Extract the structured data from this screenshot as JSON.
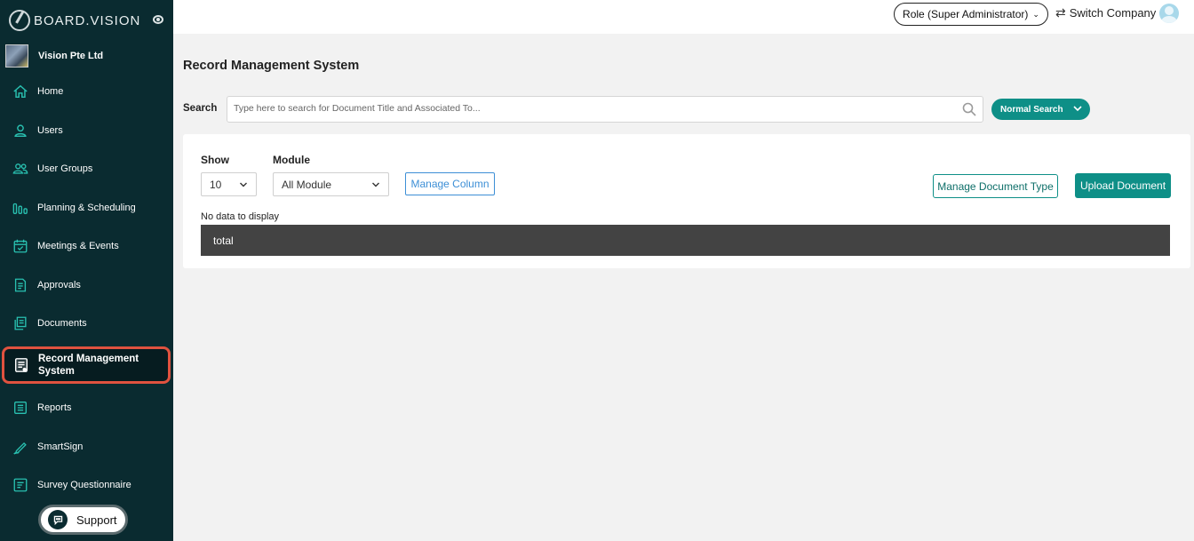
{
  "app": {
    "brand": "BOARD.VISION"
  },
  "company": {
    "name": "Vision Pte Ltd"
  },
  "sidebar": {
    "items": [
      {
        "label": "Home",
        "icon": "home-icon"
      },
      {
        "label": "Users",
        "icon": "user-icon"
      },
      {
        "label": "User Groups",
        "icon": "users-icon"
      },
      {
        "label": "Planning & Scheduling",
        "icon": "bar-chart-icon"
      },
      {
        "label": "Meetings & Events",
        "icon": "calendar-icon"
      },
      {
        "label": "Approvals",
        "icon": "approval-doc-icon"
      },
      {
        "label": "Documents",
        "icon": "documents-icon"
      },
      {
        "label": "Record Management System",
        "icon": "record-icon",
        "active": true
      },
      {
        "label": "Reports",
        "icon": "report-icon"
      },
      {
        "label": "SmartSign",
        "icon": "pen-icon"
      },
      {
        "label": "Survey Questionnaire",
        "icon": "survey-icon"
      }
    ],
    "support_label": "Support"
  },
  "topbar": {
    "role_label": "Role (Super Administrator)",
    "switch_company_label": "Switch Company"
  },
  "main": {
    "title": "Record Management System",
    "search": {
      "label": "Search",
      "placeholder": "Type here to search for Document Title and Associated To...",
      "mode_label": "Normal Search"
    },
    "controls": {
      "show_label": "Show",
      "show_value": "10",
      "module_label": "Module",
      "module_value": "All Module",
      "manage_column_label": "Manage Column",
      "manage_doc_type_label": "Manage Document Type",
      "upload_label": "Upload Document"
    },
    "table": {
      "empty_text": "No data to display",
      "total_label": "total"
    }
  },
  "colors": {
    "sidebar_bg": "#0a2b30",
    "accent": "#0e8f87",
    "icon_teal": "#29c0b0",
    "active_border": "#e0523f",
    "link_blue": "#3d8fd6"
  }
}
